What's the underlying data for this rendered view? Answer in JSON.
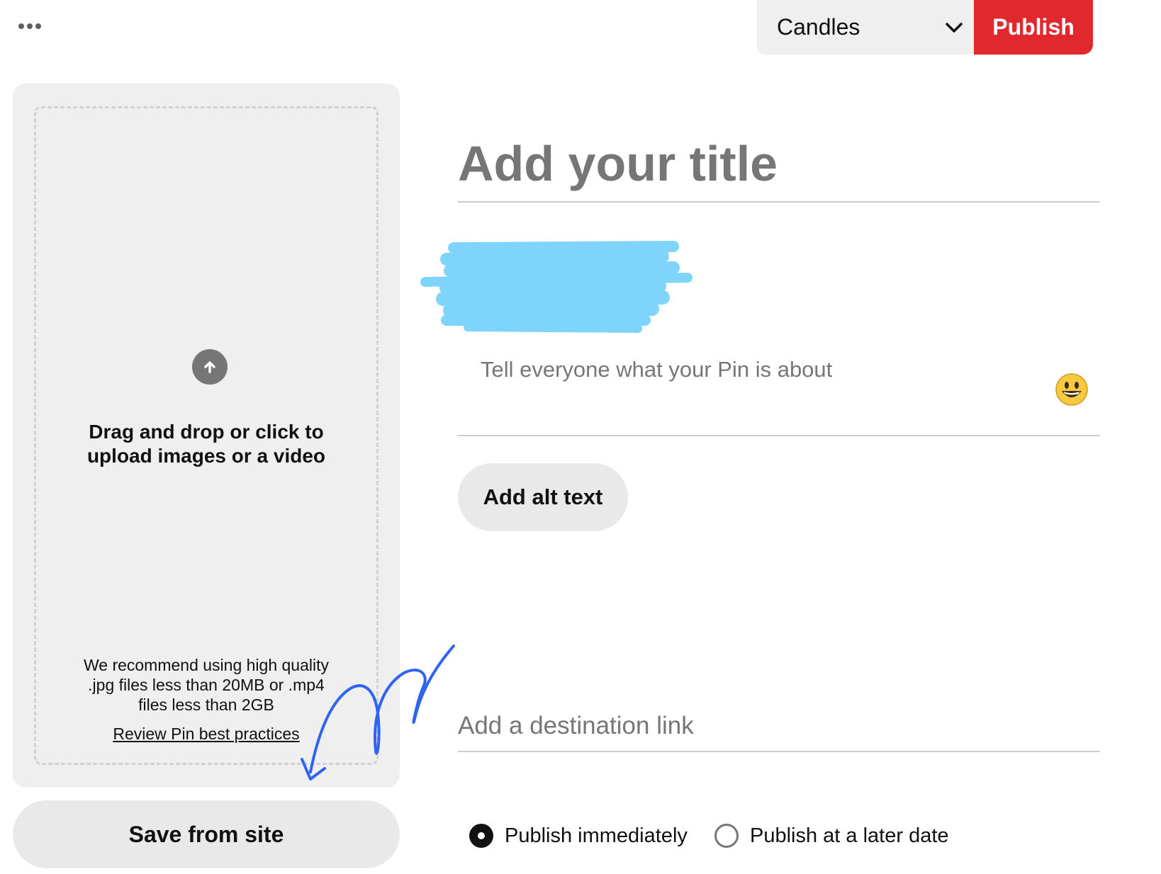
{
  "header": {
    "board_select": {
      "selected": "Candles"
    },
    "publish_label": "Publish"
  },
  "upload": {
    "drop_text_lines": [
      "Drag and drop or click to",
      "upload images or a video"
    ],
    "recommend_lines": [
      "We recommend using high quality",
      ".jpg files less than 20MB or .mp4",
      "files less than 2GB"
    ],
    "best_practices_link": "Review Pin best practices",
    "save_from_site_label": "Save from site"
  },
  "form": {
    "title_placeholder": "Add your title",
    "description_placeholder": "Tell everyone what your Pin is about",
    "alt_text_label": "Add alt text",
    "link_placeholder": "Add a destination link"
  },
  "publish_options": [
    {
      "label": "Publish immediately",
      "selected": true
    },
    {
      "label": "Publish at a later date",
      "selected": false
    }
  ],
  "colors": {
    "accent": "#e0282d",
    "redaction": "#7fd4fb",
    "annotation": "#2f64f0"
  }
}
